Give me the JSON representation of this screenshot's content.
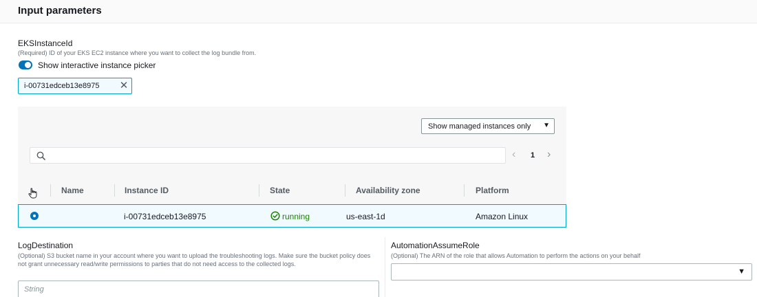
{
  "section": {
    "title": "Input parameters"
  },
  "eks_instance": {
    "label": "EKSInstanceId",
    "description": "(Required) ID of your EKS EC2 instance where you want to collect the log bundle from.",
    "toggle_label": "Show interactive instance picker",
    "toggle_on": true,
    "token_value": "i-00731edceb13e8975",
    "token_close_glyph": "✕"
  },
  "picker": {
    "filter_label": "Show managed instances only",
    "filter_caret": "▼",
    "search_placeholder": "",
    "pagination": {
      "prev_glyph": "‹",
      "page": "1",
      "next_glyph": "›"
    },
    "columns": [
      "Name",
      "Instance ID",
      "State",
      "Availability zone",
      "Platform"
    ],
    "rows": [
      {
        "selected": true,
        "name": "",
        "instance_id": "i-00731edceb13e8975",
        "state": "running",
        "availability_zone": "us-east-1d",
        "platform": "Amazon Linux"
      }
    ]
  },
  "log_destination": {
    "label": "LogDestination",
    "description": "(Optional) S3 bucket name in your account where you want to upload the troubleshooting logs. Make sure the bucket policy does not grant unnecessary read/write permissions to parties that do not need access to the collected logs.",
    "placeholder": "String"
  },
  "assume_role": {
    "label": "AutomationAssumeRole",
    "description": "(Optional) The ARN of the role that allows Automation to perform the actions on your behalf",
    "value": "",
    "caret": "▼"
  },
  "colors": {
    "accent": "#0073bb",
    "selected_border": "#00a1c9",
    "status_running": "#1d8102"
  }
}
